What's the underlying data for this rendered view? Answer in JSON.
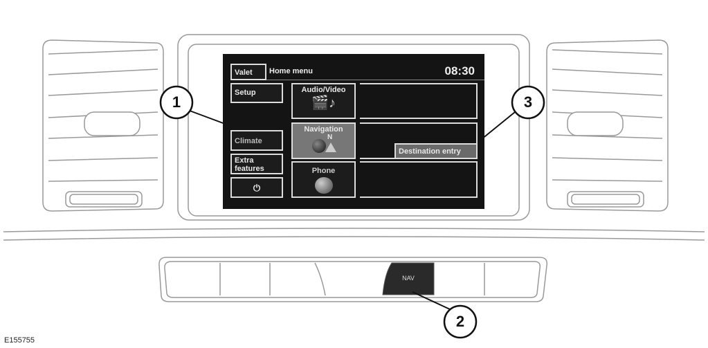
{
  "screen": {
    "valet_label": "Valet",
    "title": "Home menu",
    "clock": "08:30",
    "left_buttons": [
      "Setup",
      "Climate",
      "Extra features"
    ],
    "power_icon": "power-icon",
    "main_buttons": [
      {
        "label": "Audio/Video",
        "icon": "film-music-icon"
      },
      {
        "label": "Navigation",
        "icon": "globe-compass-icon",
        "compass_letter": "N",
        "selected": true
      },
      {
        "label": "Phone",
        "icon": "globe-phone-icon"
      }
    ],
    "destination_entry_label": "Destination entry"
  },
  "console": {
    "nav_button_label": "NAV"
  },
  "callouts": [
    "1",
    "2",
    "3"
  ],
  "figure_code": "E155755"
}
